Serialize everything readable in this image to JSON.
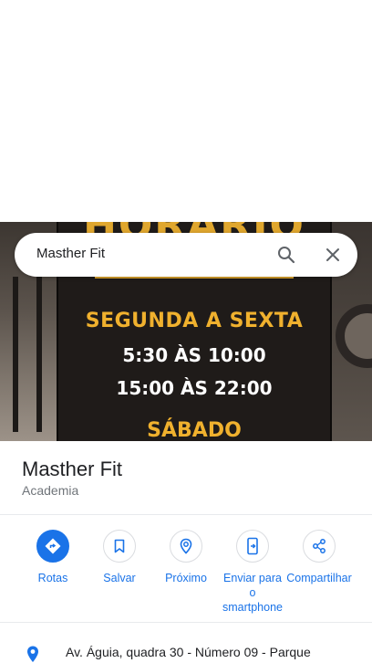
{
  "search": {
    "query": "Masther Fit"
  },
  "poster": {
    "title": "HORÁRIO",
    "weekdays": "SEGUNDA A SEXTA",
    "time_1": "5:30 ÀS 10:00",
    "time_2": "15:00 ÀS 22:00",
    "saturday": "SÁBADO"
  },
  "place": {
    "name": "Masther Fit",
    "category": "Academia"
  },
  "actions": [
    {
      "label": "Rotas",
      "icon": "directions-icon"
    },
    {
      "label": "Salvar",
      "icon": "bookmark-icon"
    },
    {
      "label": "Próximo",
      "icon": "nearby-icon"
    },
    {
      "label": "Enviar para o smartphone",
      "icon": "send-to-phone-icon"
    },
    {
      "label": "Compartilhar",
      "icon": "share-icon"
    }
  ],
  "address": {
    "text": "Av. Águia, quadra 30 - Número 09 - Parque"
  },
  "colors": {
    "accent": "#1a73e8",
    "poster_gold": "#f0b12e"
  }
}
